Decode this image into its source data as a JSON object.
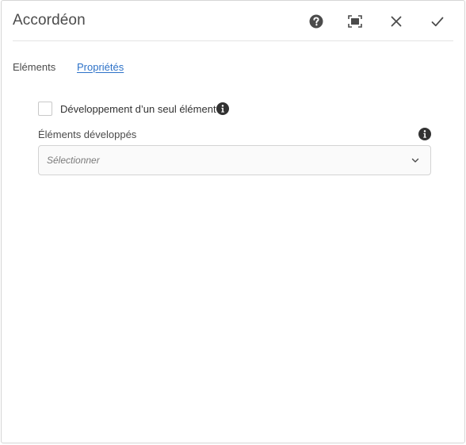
{
  "dialog": {
    "title": "Accordéon",
    "actions": [
      {
        "name": "help",
        "icon": "help-circle-icon"
      },
      {
        "name": "fullscreen",
        "icon": "fullscreen-icon"
      },
      {
        "name": "close",
        "icon": "close-icon"
      },
      {
        "name": "done",
        "icon": "checkmark-icon"
      }
    ]
  },
  "tabs": [
    {
      "label": "Eléments",
      "active": false
    },
    {
      "label": "Propriétés",
      "active": true
    }
  ],
  "properties": {
    "single_expansion": {
      "label": "Développement d’un seul élément",
      "checked": false,
      "icon": "info-icon"
    },
    "expanded_items": {
      "label": "Éléments développés",
      "placeholder": "Sélectionner",
      "icon": "info-icon"
    }
  },
  "colors": {
    "accent": "#2d72c8",
    "text": "#323232",
    "icon": "#4b4b4b",
    "border": "#d3d3d3"
  }
}
